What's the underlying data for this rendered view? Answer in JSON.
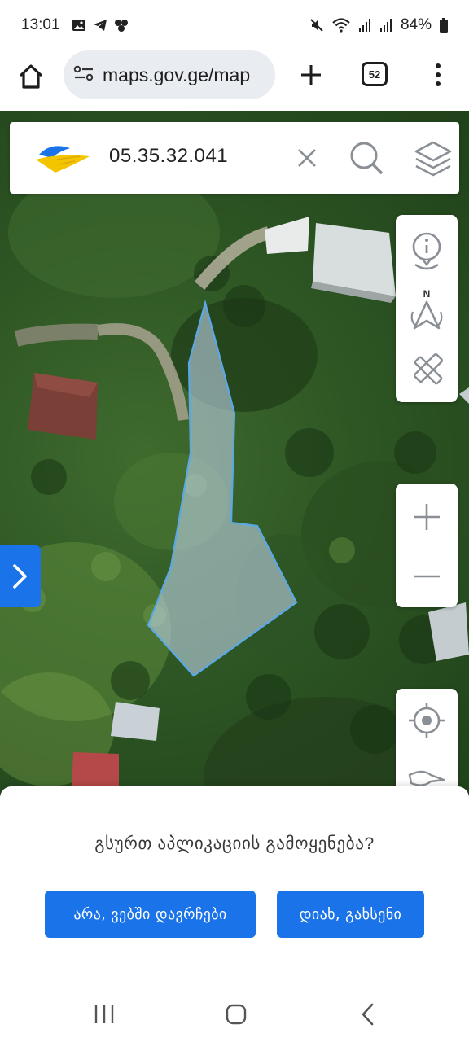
{
  "status_bar": {
    "time": "13:01",
    "battery": "84%",
    "notification_icons": [
      "gallery-icon",
      "telegram-icon",
      "messages-icon"
    ],
    "system_icons": [
      "mute-icon",
      "wifi-icon",
      "signal-icon",
      "signal-icon",
      "battery-icon"
    ]
  },
  "browser": {
    "url": "maps.gov.ge/map",
    "tab_count": "52",
    "icons": [
      "home-icon",
      "site-info-icon",
      "plus-icon",
      "tabs-icon",
      "more-vert-icon"
    ]
  },
  "search": {
    "query": "05.35.32.041",
    "icons": [
      "napr-logo",
      "close-icon",
      "search-icon",
      "layers-icon"
    ]
  },
  "map_tools": {
    "top": [
      "info-location-icon",
      "compass-north-icon",
      "measure-tools-icon"
    ],
    "zoom": [
      "zoom-in-icon",
      "zoom-out-icon"
    ],
    "bottom": [
      "my-location-icon",
      "pointer-icon"
    ],
    "compass_label": "N"
  },
  "sheet": {
    "question": "გსურთ აპლიკაციის გამოყენება?",
    "no_button": "არა, ვებში დავრჩები",
    "yes_button": "დიახ, გახსენი"
  },
  "colors": {
    "accent": "#1a73e8",
    "parcel_fill": "#b9cfe0",
    "parcel_stroke": "#5aa9e6"
  },
  "nav_bar": {
    "icons": [
      "recents-icon",
      "home-icon",
      "back-icon"
    ]
  }
}
